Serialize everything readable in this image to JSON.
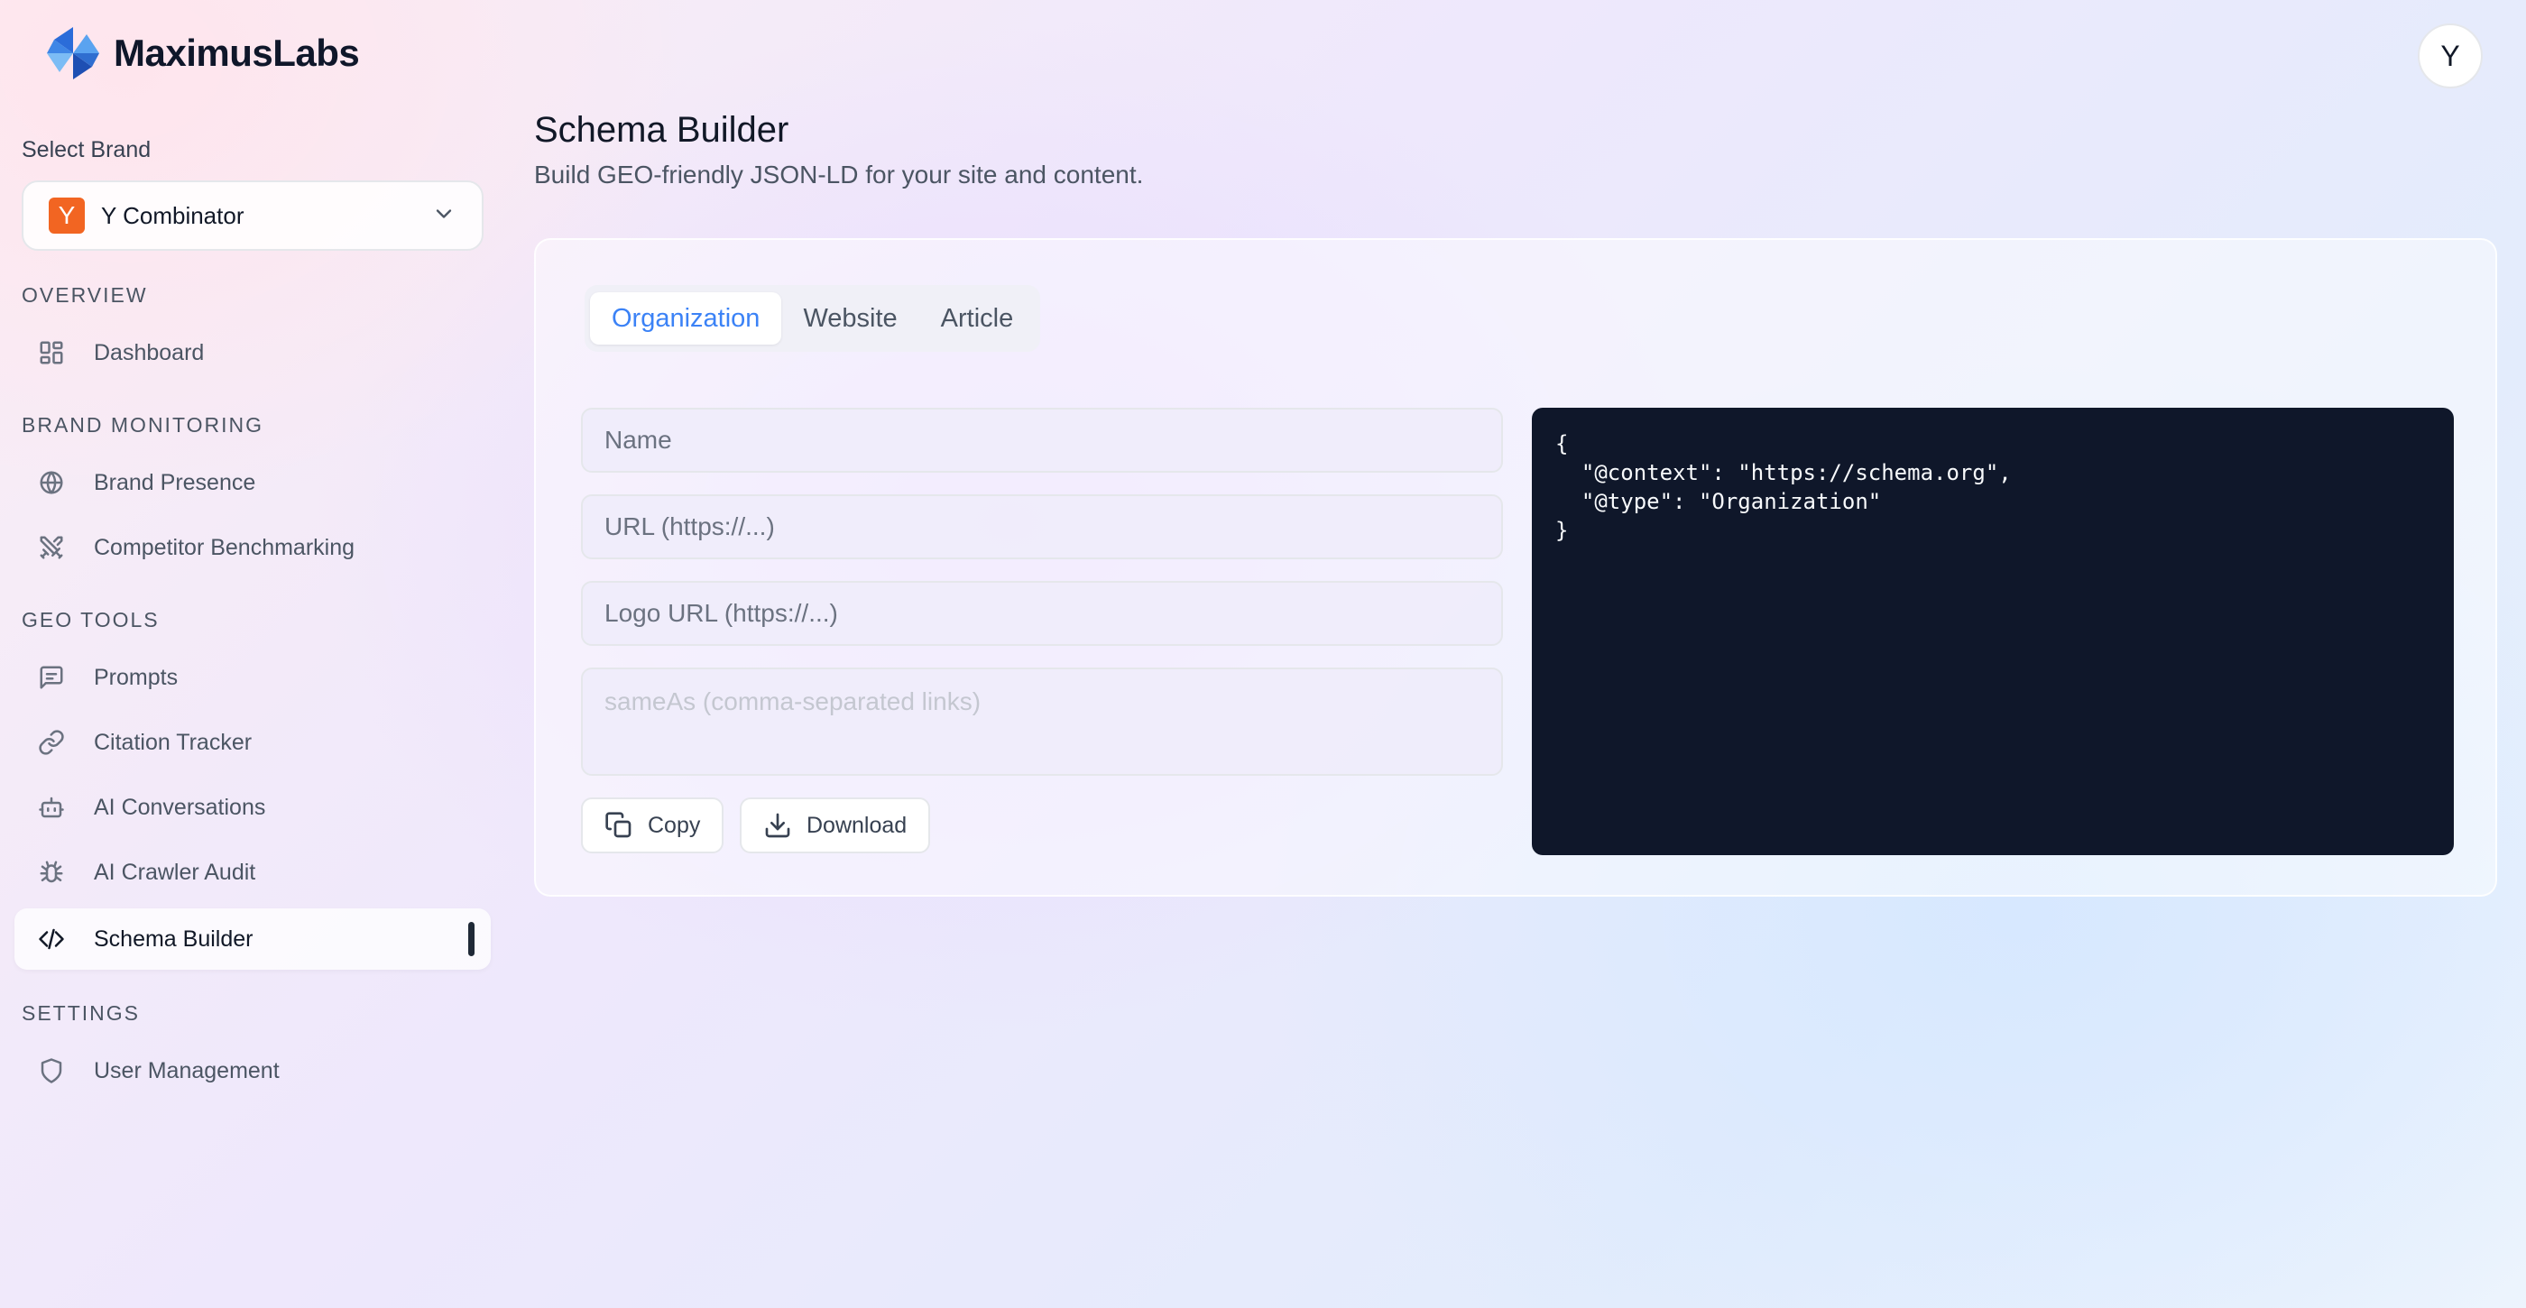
{
  "app": {
    "name": "MaximusLabs"
  },
  "sidebar": {
    "select_label": "Select Brand",
    "brand": {
      "badge": "Y",
      "name": "Y Combinator"
    },
    "sections": {
      "overview": "OVERVIEW",
      "brand_monitoring": "BRAND MONITORING",
      "geo_tools": "GEO TOOLS",
      "settings": "SETTINGS"
    },
    "items": {
      "dashboard": "Dashboard",
      "brand_presence": "Brand Presence",
      "competitor_benchmarking": "Competitor Benchmarking",
      "prompts": "Prompts",
      "citation_tracker": "Citation Tracker",
      "ai_conversations": "AI Conversations",
      "ai_crawler_audit": "AI Crawler Audit",
      "schema_builder": "Schema Builder",
      "user_management": "User Management"
    },
    "active_item": "schema_builder"
  },
  "header": {
    "avatar_initial": "Y"
  },
  "page": {
    "title": "Schema Builder",
    "subtitle": "Build GEO-friendly JSON-LD for your site and content."
  },
  "tabs": [
    {
      "label": "Organization",
      "active": true
    },
    {
      "label": "Website",
      "active": false
    },
    {
      "label": "Article",
      "active": false
    }
  ],
  "form": {
    "name_placeholder": "Name",
    "url_placeholder": "URL (https://...)",
    "logo_placeholder": "Logo URL (https://...)",
    "sameas_placeholder": "sameAs (comma-separated links)",
    "name_value": "",
    "url_value": "",
    "logo_value": "",
    "sameas_value": ""
  },
  "actions": {
    "copy": "Copy",
    "download": "Download"
  },
  "output": {
    "json": "{\n  \"@context\": \"https://schema.org\",\n  \"@type\": \"Organization\"\n}"
  },
  "colors": {
    "accent": "#3b82f6",
    "brand_badge": "#f26522",
    "code_bg": "#0f172a"
  }
}
